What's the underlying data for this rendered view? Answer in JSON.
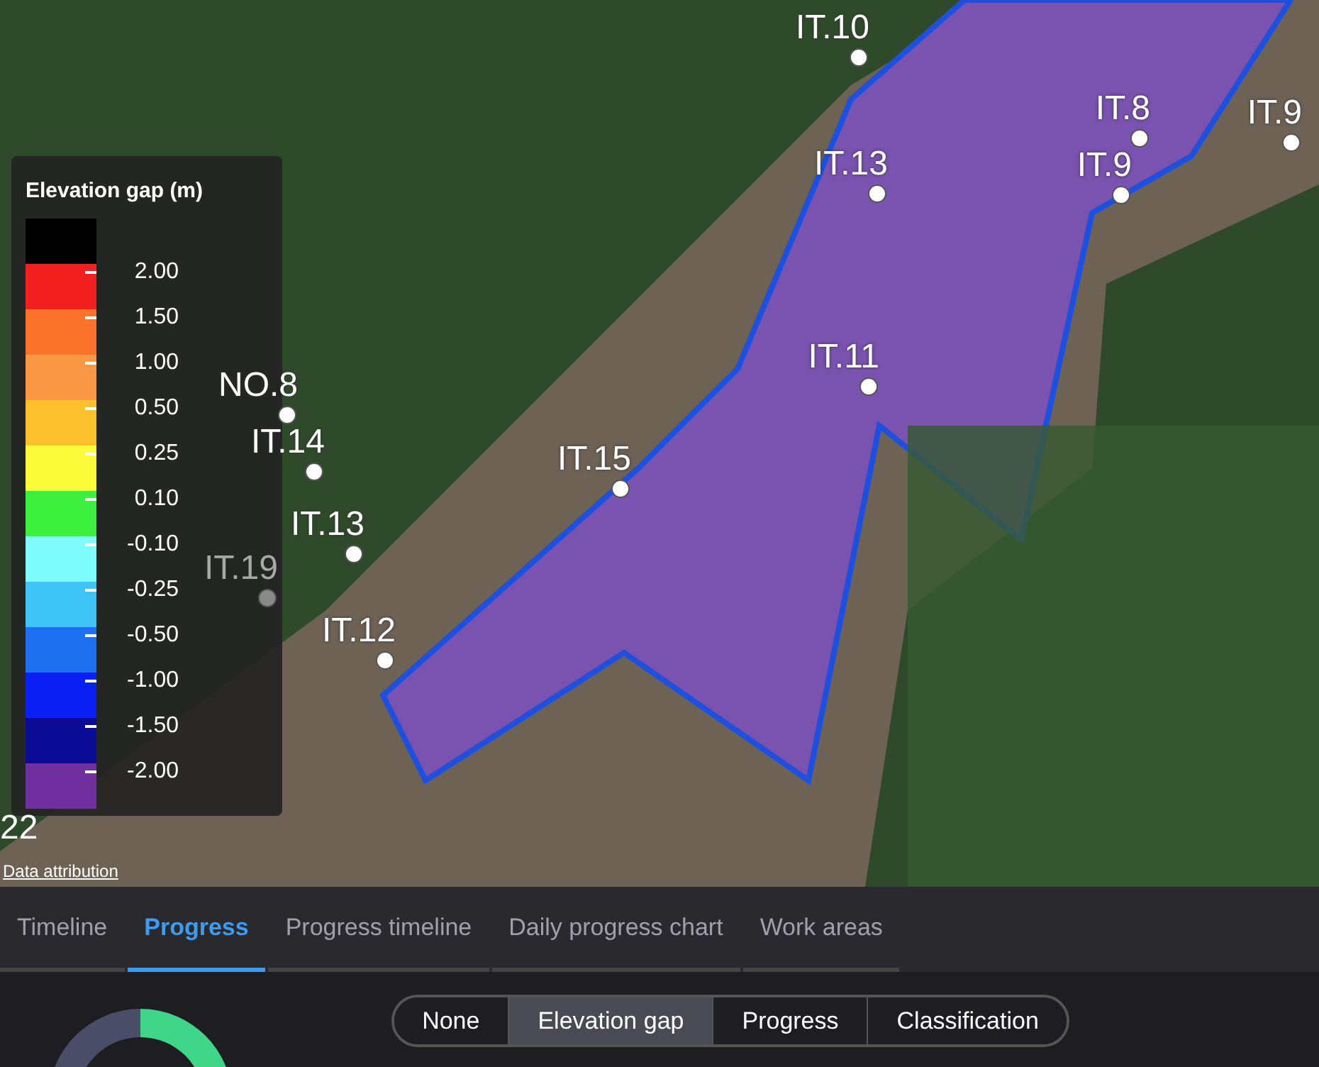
{
  "map": {
    "markers": [
      {
        "label": "IT.10"
      },
      {
        "label": "IT.8"
      },
      {
        "label": "IT.9"
      },
      {
        "label": "IT.9"
      },
      {
        "label": "IT.13"
      },
      {
        "label": "IT.11"
      },
      {
        "label": "NO.8"
      },
      {
        "label": "IT.14"
      },
      {
        "label": "IT.15"
      },
      {
        "label": "IT.13"
      },
      {
        "label": "IT.19",
        "faded": true
      },
      {
        "label": "IT.12"
      }
    ],
    "corner_label": "22",
    "attribution": "Data attribution"
  },
  "legend": {
    "title": "Elevation gap (m)",
    "bands": [
      {
        "color": "#000000"
      },
      {
        "color": "#f42020"
      },
      {
        "color": "#fb722b"
      },
      {
        "color": "#fb9846"
      },
      {
        "color": "#fbc02c"
      },
      {
        "color": "#fbfb3a"
      },
      {
        "color": "#3ef03e"
      },
      {
        "color": "#7ffcfc"
      },
      {
        "color": "#3fc4f8"
      },
      {
        "color": "#1e6ff0"
      },
      {
        "color": "#0a1ff4"
      },
      {
        "color": "#0a0a94"
      },
      {
        "color": "#7030a0"
      }
    ],
    "ticks": [
      "2.00",
      "1.50",
      "1.00",
      "0.50",
      "0.25",
      "0.10",
      "-0.10",
      "-0.25",
      "-0.50",
      "-1.00",
      "-1.50",
      "-2.00"
    ]
  },
  "tabs": [
    {
      "label": "Timeline",
      "selected": false
    },
    {
      "label": "Progress",
      "selected": true
    },
    {
      "label": "Progress timeline",
      "selected": false
    },
    {
      "label": "Daily progress chart",
      "selected": false
    },
    {
      "label": "Work areas",
      "selected": false
    }
  ],
  "view_modes": [
    {
      "label": "None",
      "selected": false
    },
    {
      "label": "Elevation gap",
      "selected": true
    },
    {
      "label": "Progress",
      "selected": false
    },
    {
      "label": "Classification",
      "selected": false
    }
  ]
}
